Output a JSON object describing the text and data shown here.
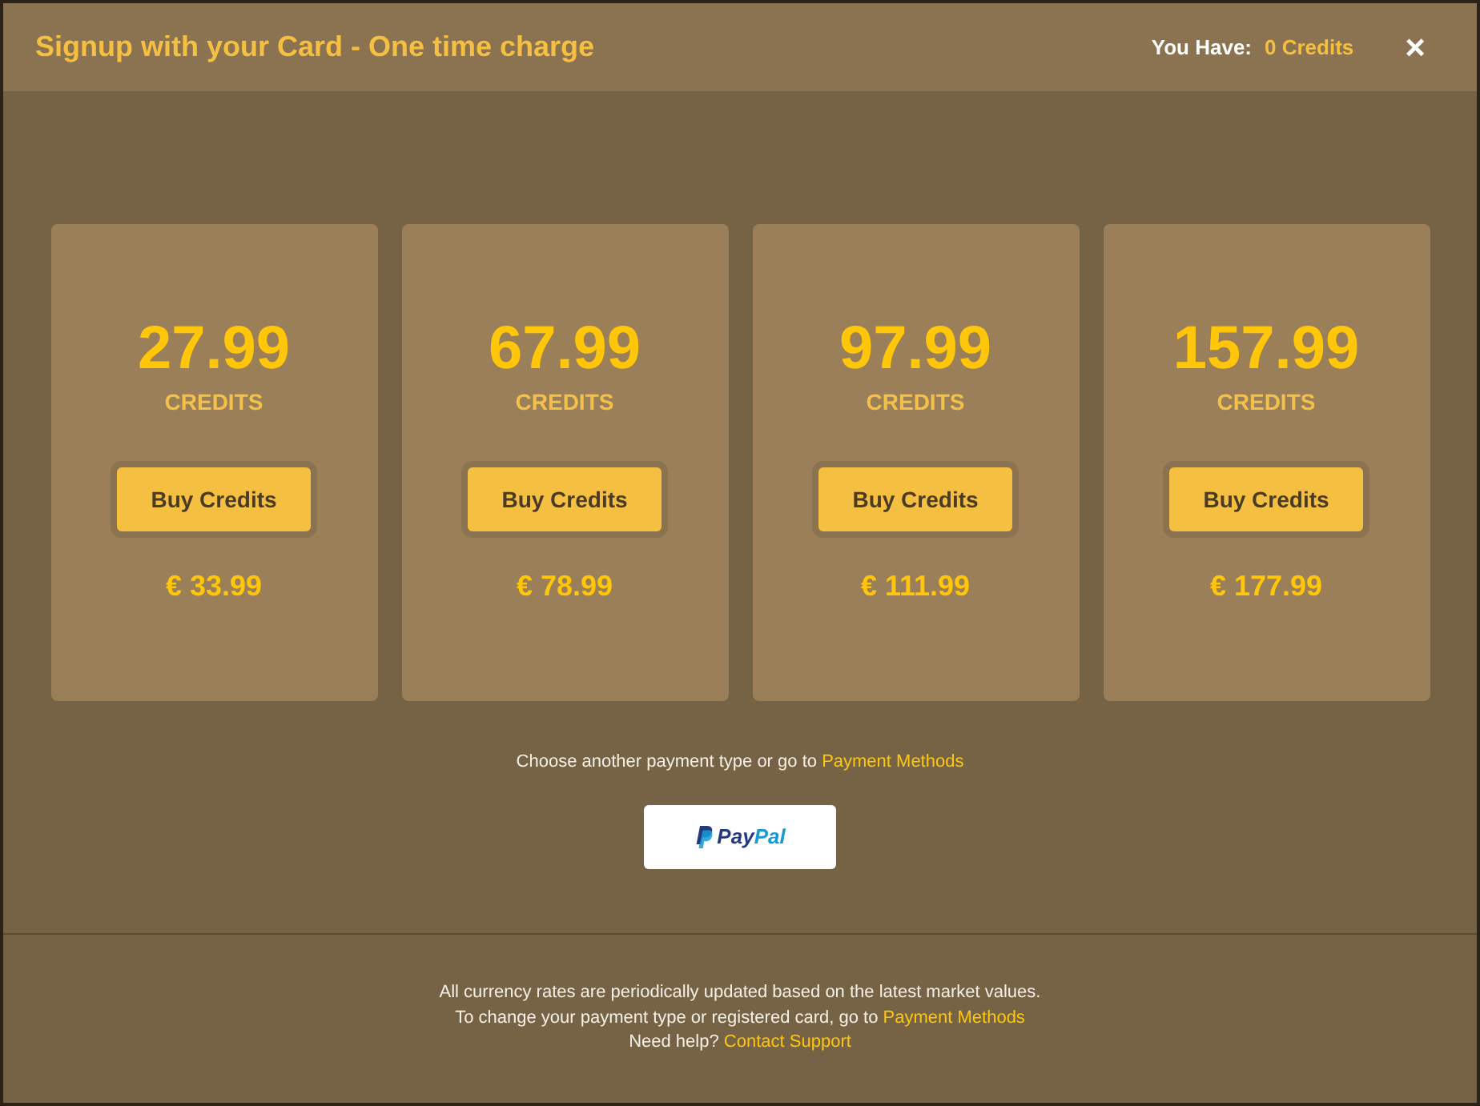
{
  "window": {
    "title": "Signup with your Card - One time charge",
    "balance_label": "You Have:",
    "balance_value": "0 Credits",
    "close": "×"
  },
  "packages": [
    {
      "credits": "27.99",
      "unit": "CREDITS",
      "button": "Buy Credits",
      "price": "€ 33.99"
    },
    {
      "credits": "67.99",
      "unit": "CREDITS",
      "button": "Buy Credits",
      "price": "€ 78.99"
    },
    {
      "credits": "97.99",
      "unit": "CREDITS",
      "button": "Buy Credits",
      "price": "€ 111.99"
    },
    {
      "credits": "157.99",
      "unit": "CREDITS",
      "button": "Buy Credits",
      "price": "€ 177.99"
    }
  ],
  "payment_prompt": {
    "text": "Choose another payment type or go to",
    "link": "Payment Methods"
  },
  "paypal_button": {
    "label_parts": [
      "Pay",
      "Pal"
    ]
  },
  "footer": [
    {
      "text": "All currency rates are periodically updated based on the latest market values."
    },
    {
      "text": "To change your payment type or registered card, go to",
      "link": "Payment Methods"
    },
    {
      "text": "Need help?",
      "link": "Contact Support"
    }
  ]
}
